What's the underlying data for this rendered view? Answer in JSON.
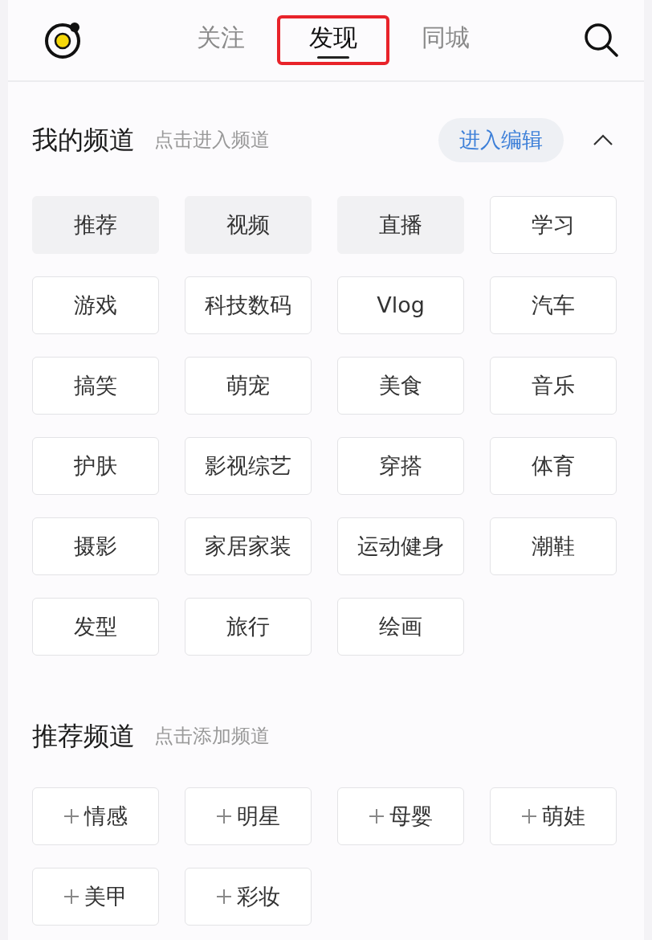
{
  "header": {
    "tabs": [
      {
        "label": "关注",
        "selected": false,
        "highlighted": false
      },
      {
        "label": "发现",
        "selected": true,
        "highlighted": true
      },
      {
        "label": "同城",
        "selected": false,
        "highlighted": false
      }
    ]
  },
  "my_channels": {
    "title": "我的频道",
    "hint": "点击进入频道",
    "edit_button": "进入编辑",
    "expanded": true,
    "items": [
      {
        "label": "推荐",
        "fixed": true
      },
      {
        "label": "视频",
        "fixed": true
      },
      {
        "label": "直播",
        "fixed": true
      },
      {
        "label": "学习",
        "fixed": false
      },
      {
        "label": "游戏",
        "fixed": false
      },
      {
        "label": "科技数码",
        "fixed": false
      },
      {
        "label": "Vlog",
        "fixed": false
      },
      {
        "label": "汽车",
        "fixed": false
      },
      {
        "label": "搞笑",
        "fixed": false
      },
      {
        "label": "萌宠",
        "fixed": false
      },
      {
        "label": "美食",
        "fixed": false
      },
      {
        "label": "音乐",
        "fixed": false
      },
      {
        "label": "护肤",
        "fixed": false
      },
      {
        "label": "影视综艺",
        "fixed": false
      },
      {
        "label": "穿搭",
        "fixed": false
      },
      {
        "label": "体育",
        "fixed": false
      },
      {
        "label": "摄影",
        "fixed": false
      },
      {
        "label": "家居家装",
        "fixed": false
      },
      {
        "label": "运动健身",
        "fixed": false
      },
      {
        "label": "潮鞋",
        "fixed": false
      },
      {
        "label": "发型",
        "fixed": false
      },
      {
        "label": "旅行",
        "fixed": false
      },
      {
        "label": "绘画",
        "fixed": false
      }
    ]
  },
  "recommended_channels": {
    "title": "推荐频道",
    "hint": "点击添加频道",
    "items": [
      {
        "label": "情感"
      },
      {
        "label": "明星"
      },
      {
        "label": "母婴"
      },
      {
        "label": "萌娃"
      },
      {
        "label": "美甲"
      },
      {
        "label": "彩妆"
      }
    ]
  }
}
